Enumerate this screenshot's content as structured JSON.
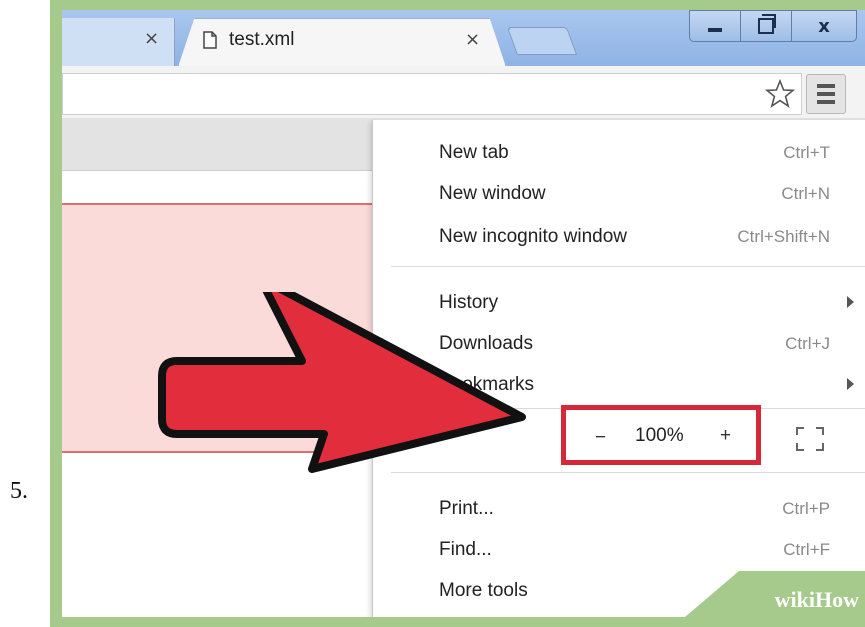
{
  "step": {
    "number": "5."
  },
  "tabs": {
    "previous": {
      "close_glyph": "×"
    },
    "active": {
      "title": "test.xml",
      "close_glyph": "×",
      "icon": "document-icon"
    },
    "new_tab_icon": "new-tab-icon"
  },
  "window_controls": {
    "minimize_icon": "minimize-icon",
    "maximize_icon": "restore-icon",
    "close_glyph": "x"
  },
  "toolbar": {
    "bookmark_icon": "star-icon",
    "menu_icon": "hamburger-menu-icon"
  },
  "menu": {
    "items": [
      {
        "label": "New tab",
        "shortcut": "Ctrl+T"
      },
      {
        "label": "New window",
        "shortcut": "Ctrl+N"
      },
      {
        "label": "New incognito window",
        "shortcut": "Ctrl+Shift+N"
      },
      {
        "label": "History",
        "shortcut": "",
        "submenu": true
      },
      {
        "label": "Downloads",
        "shortcut": "Ctrl+J"
      },
      {
        "label": "Bookmarks",
        "shortcut": "",
        "submenu": true
      },
      {
        "label": "Print...",
        "shortcut": "Ctrl+P"
      },
      {
        "label": "Find...",
        "shortcut": "Ctrl+F"
      },
      {
        "label": "More tools",
        "shortcut": "",
        "submenu": true
      }
    ],
    "zoom": {
      "minus": "−",
      "level": "100%",
      "plus": "+",
      "fullscreen_icon": "fullscreen-icon"
    }
  },
  "annotation": {
    "arrow_color": "#e12d3c",
    "highlight_color": "#d6283a"
  },
  "watermark": {
    "wiki": "wiki",
    "how": "How"
  }
}
